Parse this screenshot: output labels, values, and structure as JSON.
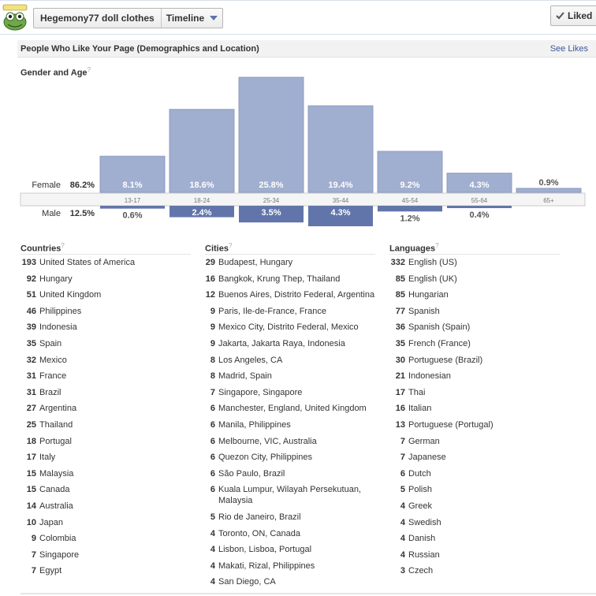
{
  "header": {
    "page_name": "Hegemony77 doll clothes",
    "timeline_label": "Timeline",
    "liked_label": "Liked",
    "logo_text": "Hegemony77"
  },
  "section": {
    "title": "People Who Like Your Page (Demographics and Location)",
    "see_likes": "See Likes"
  },
  "gender_age": {
    "title": "Gender and Age",
    "help": "?"
  },
  "chart_data": {
    "type": "bar",
    "categories": [
      "13-17",
      "18-24",
      "25-34",
      "35-44",
      "45-54",
      "55-64",
      "65+"
    ],
    "series": [
      {
        "name": "Female",
        "total": "86.2%",
        "values": [
          8.1,
          18.6,
          25.8,
          19.4,
          9.2,
          4.3,
          0.9
        ]
      },
      {
        "name": "Male",
        "total": "12.5%",
        "values": [
          0.6,
          2.4,
          3.5,
          4.3,
          1.2,
          0.4,
          0
        ]
      }
    ],
    "female_labels": [
      "8.1%",
      "18.6%",
      "25.8%",
      "19.4%",
      "9.2%",
      "4.3%",
      "0.9%"
    ],
    "male_labels": [
      "0.6%",
      "2.4%",
      "3.5%",
      "4.3%",
      "1.2%",
      "0.4%",
      ""
    ],
    "colors": {
      "female": "#a0aed0",
      "male": "#6275ab",
      "age_row": "#f5f5f5"
    }
  },
  "countries": {
    "title": "Countries",
    "help": "?",
    "items": [
      {
        "count": "193",
        "name": "United States of America"
      },
      {
        "count": "92",
        "name": "Hungary"
      },
      {
        "count": "51",
        "name": "United Kingdom"
      },
      {
        "count": "46",
        "name": "Philippines"
      },
      {
        "count": "39",
        "name": "Indonesia"
      },
      {
        "count": "35",
        "name": "Spain"
      },
      {
        "count": "32",
        "name": "Mexico"
      },
      {
        "count": "31",
        "name": "France"
      },
      {
        "count": "31",
        "name": "Brazil"
      },
      {
        "count": "27",
        "name": "Argentina"
      },
      {
        "count": "25",
        "name": "Thailand"
      },
      {
        "count": "18",
        "name": "Portugal"
      },
      {
        "count": "17",
        "name": "Italy"
      },
      {
        "count": "15",
        "name": "Malaysia"
      },
      {
        "count": "15",
        "name": "Canada"
      },
      {
        "count": "14",
        "name": "Australia"
      },
      {
        "count": "10",
        "name": "Japan"
      },
      {
        "count": "9",
        "name": "Colombia"
      },
      {
        "count": "7",
        "name": "Singapore"
      },
      {
        "count": "7",
        "name": "Egypt"
      }
    ]
  },
  "cities": {
    "title": "Cities",
    "help": "?",
    "items": [
      {
        "count": "29",
        "name": "Budapest, Hungary"
      },
      {
        "count": "16",
        "name": "Bangkok, Krung Thep, Thailand"
      },
      {
        "count": "12",
        "name": "Buenos Aires, Distrito Federal, Argentina"
      },
      {
        "count": "9",
        "name": "Paris, Ile-de-France, France"
      },
      {
        "count": "9",
        "name": "Mexico City, Distrito Federal, Mexico"
      },
      {
        "count": "9",
        "name": "Jakarta, Jakarta Raya, Indonesia"
      },
      {
        "count": "8",
        "name": "Los Angeles, CA"
      },
      {
        "count": "8",
        "name": "Madrid, Spain"
      },
      {
        "count": "7",
        "name": "Singapore, Singapore"
      },
      {
        "count": "6",
        "name": "Manchester, England, United Kingdom"
      },
      {
        "count": "6",
        "name": "Manila, Philippines"
      },
      {
        "count": "6",
        "name": "Melbourne, VIC, Australia"
      },
      {
        "count": "6",
        "name": "Quezon City, Philippines"
      },
      {
        "count": "6",
        "name": "São Paulo, Brazil"
      },
      {
        "count": "6",
        "name": "Kuala Lumpur, Wilayah Persekutuan, Malaysia"
      },
      {
        "count": "5",
        "name": "Rio de Janeiro, Brazil"
      },
      {
        "count": "4",
        "name": "Toronto, ON, Canada"
      },
      {
        "count": "4",
        "name": "Lisbon, Lisboa, Portugal"
      },
      {
        "count": "4",
        "name": "Makati, Rizal, Philippines"
      },
      {
        "count": "4",
        "name": "San Diego, CA"
      }
    ]
  },
  "languages": {
    "title": "Languages",
    "help": "?",
    "items": [
      {
        "count": "332",
        "name": "English (US)"
      },
      {
        "count": "85",
        "name": "English (UK)"
      },
      {
        "count": "85",
        "name": "Hungarian"
      },
      {
        "count": "77",
        "name": "Spanish"
      },
      {
        "count": "36",
        "name": "Spanish (Spain)"
      },
      {
        "count": "35",
        "name": "French (France)"
      },
      {
        "count": "30",
        "name": "Portuguese (Brazil)"
      },
      {
        "count": "21",
        "name": "Indonesian"
      },
      {
        "count": "17",
        "name": "Thai"
      },
      {
        "count": "16",
        "name": "Italian"
      },
      {
        "count": "13",
        "name": "Portuguese (Portugal)"
      },
      {
        "count": "7",
        "name": "German"
      },
      {
        "count": "7",
        "name": "Japanese"
      },
      {
        "count": "6",
        "name": "Dutch"
      },
      {
        "count": "5",
        "name": "Polish"
      },
      {
        "count": "4",
        "name": "Greek"
      },
      {
        "count": "4",
        "name": "Swedish"
      },
      {
        "count": "4",
        "name": "Danish"
      },
      {
        "count": "4",
        "name": "Russian"
      },
      {
        "count": "3",
        "name": "Czech"
      }
    ]
  }
}
